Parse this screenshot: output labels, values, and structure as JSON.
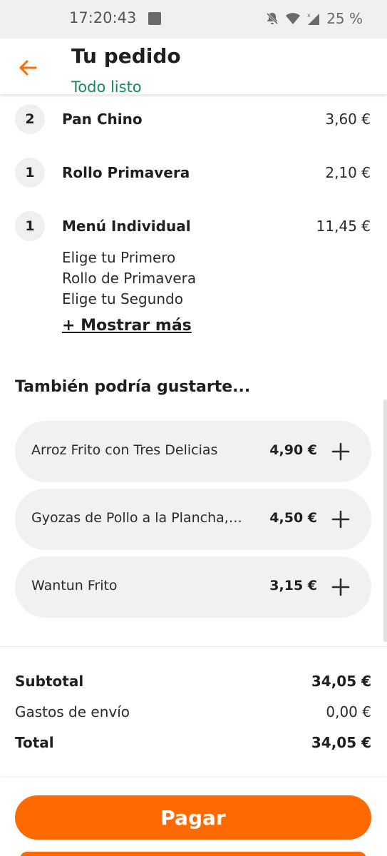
{
  "status_bar": {
    "time": "17:20:43",
    "battery": "25 %"
  },
  "header": {
    "title": "Tu pedido",
    "subtitle": "Todo listo",
    "accent_color": "#ff6a00",
    "subtitle_color": "#1a8a55"
  },
  "order_items": [
    {
      "qty": "2",
      "name": "Pan Chino",
      "price": "3,60 €"
    },
    {
      "qty": "1",
      "name": "Rollo Primavera",
      "price": "2,10 €"
    },
    {
      "qty": "1",
      "name": "Menú Individual",
      "price": "11,45 €",
      "details": [
        "Elige tu Primero",
        "Rollo de Primavera",
        "Elige tu Segundo"
      ],
      "show_more": "+ Mostrar más"
    }
  ],
  "suggestions": {
    "title": "También podría gustarte...",
    "items": [
      {
        "name": "Arroz Frito con Tres Delicias",
        "price": "4,90 €"
      },
      {
        "name": "Gyozas de Pollo a la Plancha, 6...",
        "price": "4,50 €"
      },
      {
        "name": "Wantun Frito",
        "price": "3,15 €"
      }
    ]
  },
  "summary": {
    "subtotal_label": "Subtotal",
    "subtotal_value": "34,05 €",
    "delivery_label": "Gastos de envío",
    "delivery_value": "0,00 €",
    "total_label": "Total",
    "total_value": "34,05 €"
  },
  "footer": {
    "pay_label": "Pagar"
  }
}
